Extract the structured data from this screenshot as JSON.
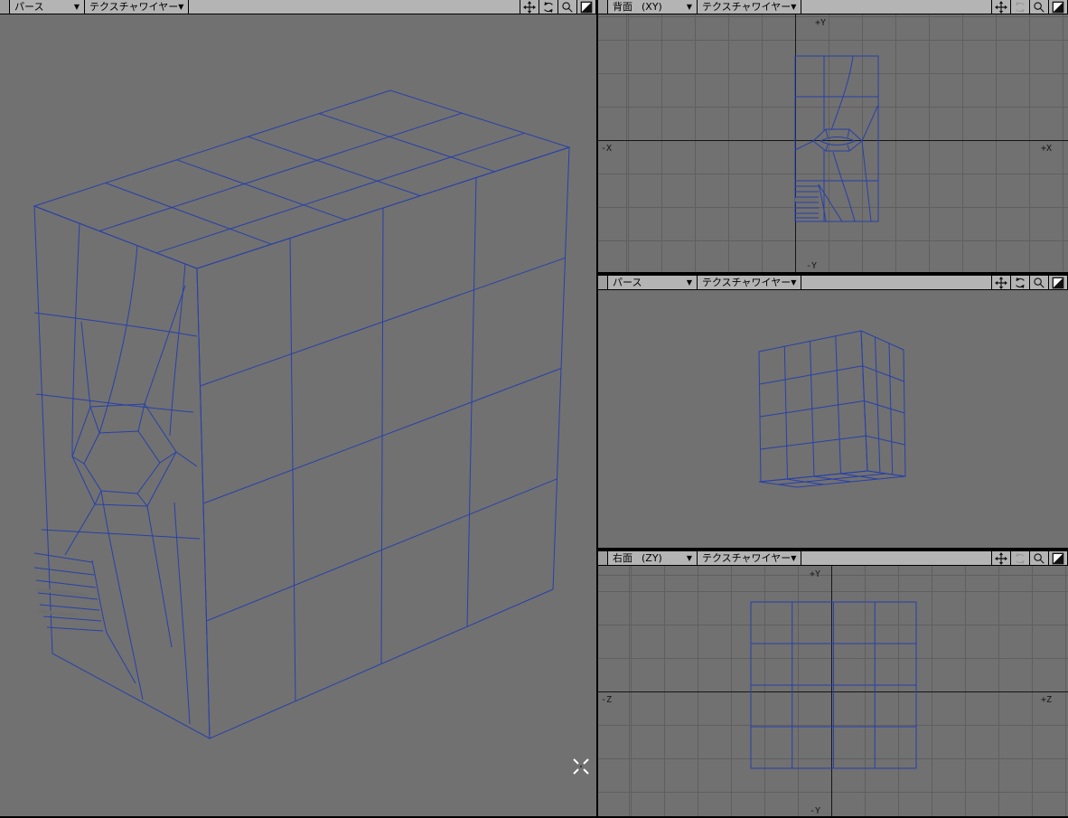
{
  "app": {
    "name": "3d-modeler-quad-view"
  },
  "icons": {
    "dropdown_arrow": "▼"
  },
  "colors": {
    "canvas_bg": "#717171",
    "grid_line": "#5f5f5f",
    "axis_line": "#151515",
    "wireframe": "#2840a8",
    "header_bg": "#b4b4b4",
    "hole_gray": "#6e6e6e",
    "main_top_blue": "#6e94c4",
    "main_front_purple": "#a687cb",
    "main_side_green": "#6f9b60",
    "back_view_purple": "#b191d9",
    "persp_front_green": "#abdc9b",
    "persp_side_olive": "#9c8c3c",
    "persp_bottom_red": "#8c4a3a",
    "side_view_green": "#9ccb8c"
  },
  "viewports": {
    "main": {
      "view_label": "パース",
      "display_mode": "テクスチャワイヤー",
      "tools": {
        "move_enabled": true,
        "rotate_enabled": true,
        "zoom_enabled": true,
        "maximize_enabled": true
      }
    },
    "back": {
      "view_label": "背面",
      "axis_suffix": "(XY)",
      "display_mode": "テクスチャワイヤー",
      "axis_top": "+Y",
      "axis_left": "-X",
      "axis_right": "+X",
      "axis_bottom": "-Y",
      "tools": {
        "move_enabled": true,
        "rotate_enabled": false,
        "zoom_enabled": true,
        "maximize_enabled": true
      }
    },
    "persp": {
      "view_label": "パース",
      "display_mode": "テクスチャワイヤー",
      "tools": {
        "move_enabled": true,
        "rotate_enabled": true,
        "zoom_enabled": true,
        "maximize_enabled": true
      }
    },
    "side": {
      "view_label": "右面",
      "axis_suffix": "(ZY)",
      "display_mode": "テクスチャワイヤー",
      "axis_top": "+Y",
      "axis_left": "-Z",
      "axis_right": "+Z",
      "axis_bottom": "-Y",
      "tools": {
        "move_enabled": true,
        "rotate_enabled": false,
        "zoom_enabled": true,
        "maximize_enabled": true
      }
    }
  }
}
